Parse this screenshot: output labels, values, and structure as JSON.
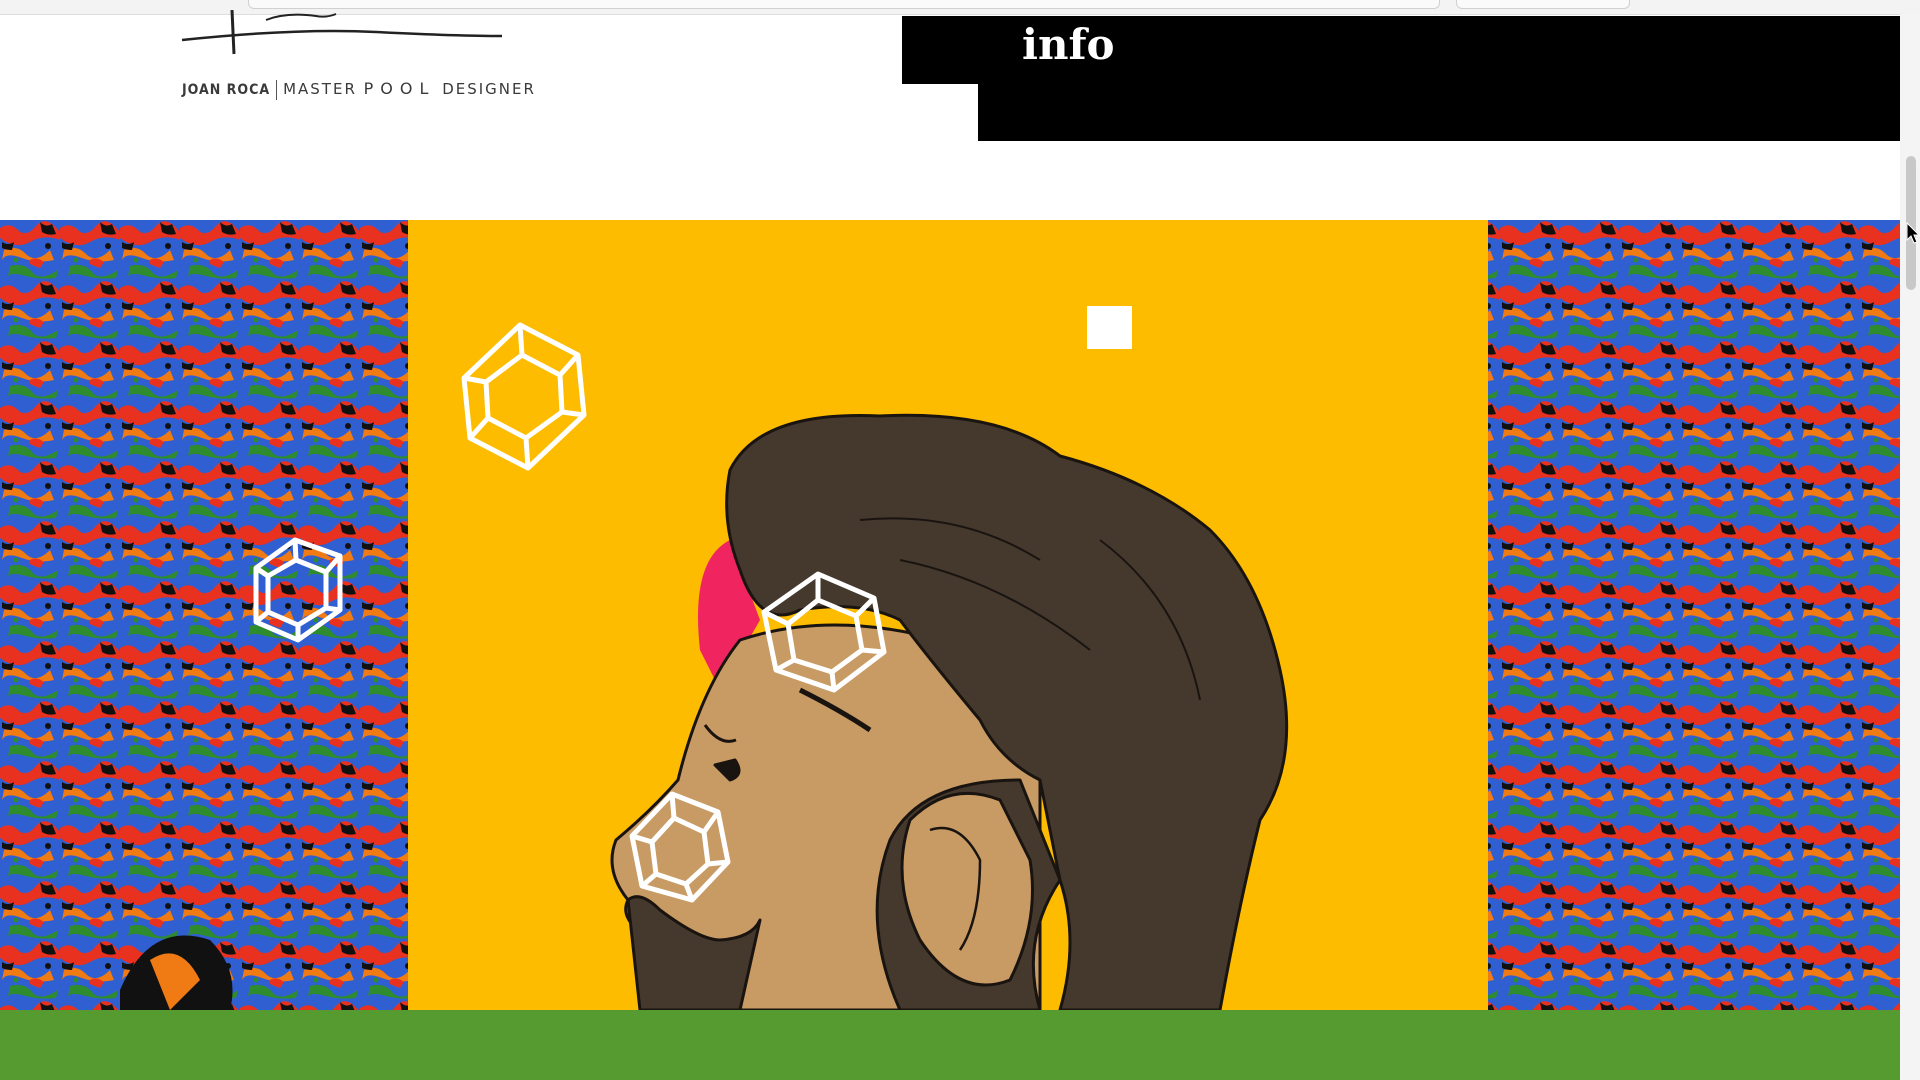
{
  "header": {
    "logo": {
      "name": "JOAN ROCA",
      "title_prefix": "MASTER",
      "title_accent": "POOL",
      "title_suffix": "DESIGNER"
    },
    "menu_label": "info"
  },
  "hero": {
    "background_color": "#fdbc00",
    "side_panel_colors": [
      "#e8321f",
      "#2f5fd1",
      "#2e8b2e",
      "#f07a14",
      "#000000"
    ],
    "footer_color": "#559b30"
  }
}
